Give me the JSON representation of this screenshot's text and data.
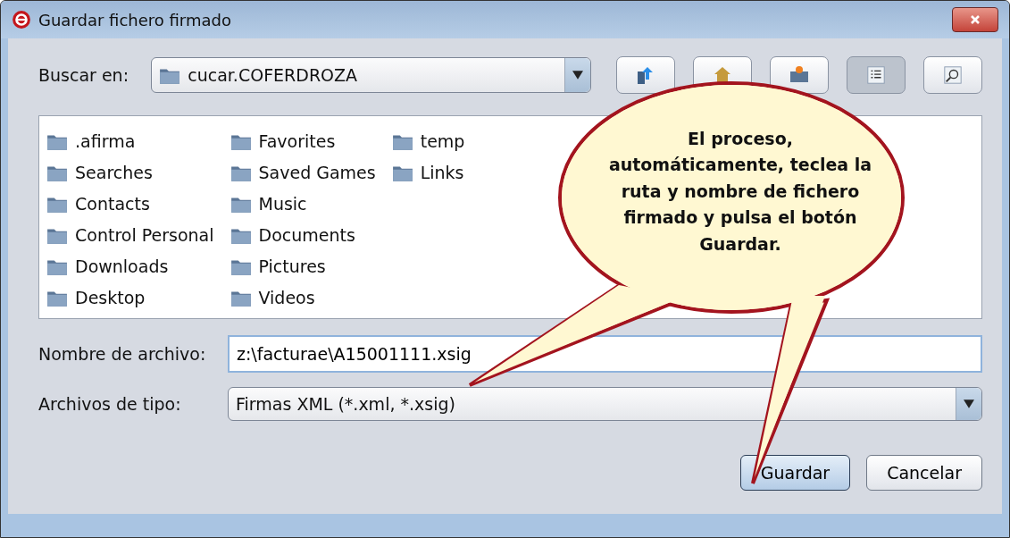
{
  "window": {
    "title": "Guardar fichero firmado"
  },
  "look_in": {
    "label": "Buscar en:",
    "value": "cucar.COFERDROZA"
  },
  "toolbar": [
    {
      "kind": "up",
      "selected": false
    },
    {
      "kind": "home",
      "selected": false
    },
    {
      "kind": "newfolder",
      "selected": false
    },
    {
      "kind": "list",
      "selected": true
    },
    {
      "kind": "details",
      "selected": false
    }
  ],
  "files": [
    ".afirma",
    "Searches",
    "Contacts",
    "Control Personal",
    "Downloads",
    "Desktop",
    "Favorites",
    "Saved Games",
    "Music",
    "Documents",
    "Pictures",
    "Videos",
    "temp",
    "Links"
  ],
  "file_name": {
    "label": "Nombre de archivo:",
    "value": "z:\\facturae\\A15001111.xsig"
  },
  "file_type": {
    "label": "Archivos de tipo:",
    "value": "Firmas XML (*.xml, *.xsig)"
  },
  "buttons": [
    {
      "label": "Guardar",
      "default": true
    },
    {
      "label": "Cancelar",
      "default": false
    }
  ],
  "callout": {
    "text": "El proceso, automáticamente, teclea la ruta y nombre de fichero firmado y pulsa el botón Guardar."
  }
}
